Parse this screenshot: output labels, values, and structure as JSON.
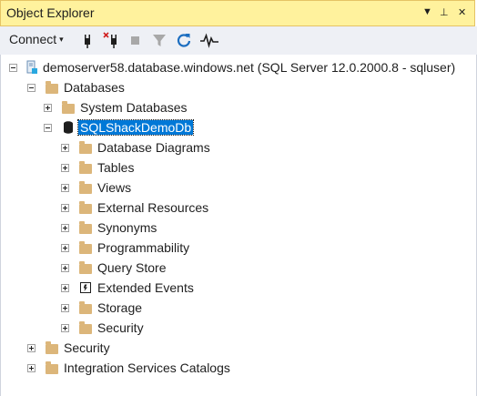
{
  "window": {
    "title": "Object Explorer",
    "controls": [
      "▼",
      "⊥",
      "✕"
    ]
  },
  "toolbar": {
    "connect_label": "Connect",
    "connect_arrow": "▾",
    "buttons": [
      "connect-plug-icon",
      "disconnect-plug-icon",
      "stop-icon",
      "filter-icon",
      "refresh-icon",
      "activity-monitor-icon"
    ]
  },
  "tree": {
    "server": "demoserver58.database.windows.net (SQL Server 12.0.2000.8 - sqluser)",
    "databases": "Databases",
    "system_databases": "System Databases",
    "selected_db": "SQLShackDemoDb",
    "db_children": [
      "Database Diagrams",
      "Tables",
      "Views",
      "External Resources",
      "Synonyms",
      "Programmability",
      "Query Store",
      "Extended Events",
      "Storage",
      "Security"
    ],
    "security": "Security",
    "integration_services": "Integration Services Catalogs"
  },
  "colors": {
    "title_bg": "#fff29d",
    "toolbar_bg": "#eef0f5",
    "selection": "#0078d7",
    "folder": "#dcb67a"
  }
}
